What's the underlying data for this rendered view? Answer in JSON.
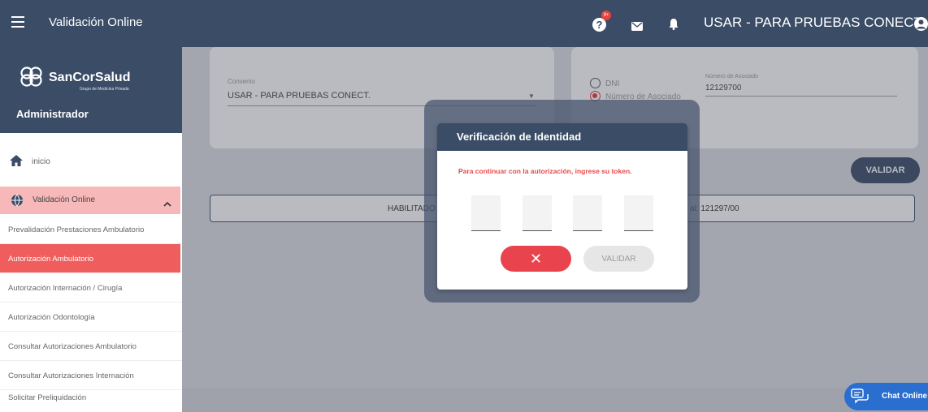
{
  "topbar": {
    "title": "Validación Online",
    "help_badge": "9+",
    "user_name": "USAR - PARA PRUEBAS CONECT.,",
    "icons": [
      "menu-icon",
      "help-icon",
      "mail-icon",
      "bell-icon",
      "user-icon"
    ]
  },
  "sidebar": {
    "brand": "SanCorSalud",
    "brand_sub": "Grupo de Medicina Privada",
    "role": "Administrador",
    "inicio": "inicio",
    "section": "Validación Online",
    "items": [
      "Prevalidación Prestaciones Ambulatorio",
      "Autorización Ambulatorio",
      "Autorización Internación / Cirugía",
      "Autorización Odontología",
      "Consultar Autorizaciones Ambulatorio",
      "Consultar Autorizaciones Internación",
      "Solicitar Preliquidación"
    ],
    "active_index": 1
  },
  "form": {
    "convenio_label": "Convenio",
    "convenio_value": "USAR - PARA PRUEBAS CONECT.",
    "radio_dni": "DNI",
    "radio_asociado": "Número de Asociado",
    "asociado_label": "Número de Asociado",
    "asociado_value": "12129700",
    "validar": "VALIDAR"
  },
  "status_bar": {
    "left": "HABILITADO",
    "right": "al: 121297/00"
  },
  "modal": {
    "title": "Verificación de Identidad",
    "message": "Para continuar con la autorización, ingrese su token.",
    "validar": "VALIDAR",
    "cancel_symbol": "✕"
  },
  "chat": {
    "label": "Chat Online"
  },
  "colors": {
    "navy": "#3a4c66",
    "accent_red": "#f05d5d",
    "chat_blue": "#2a6ecf"
  }
}
